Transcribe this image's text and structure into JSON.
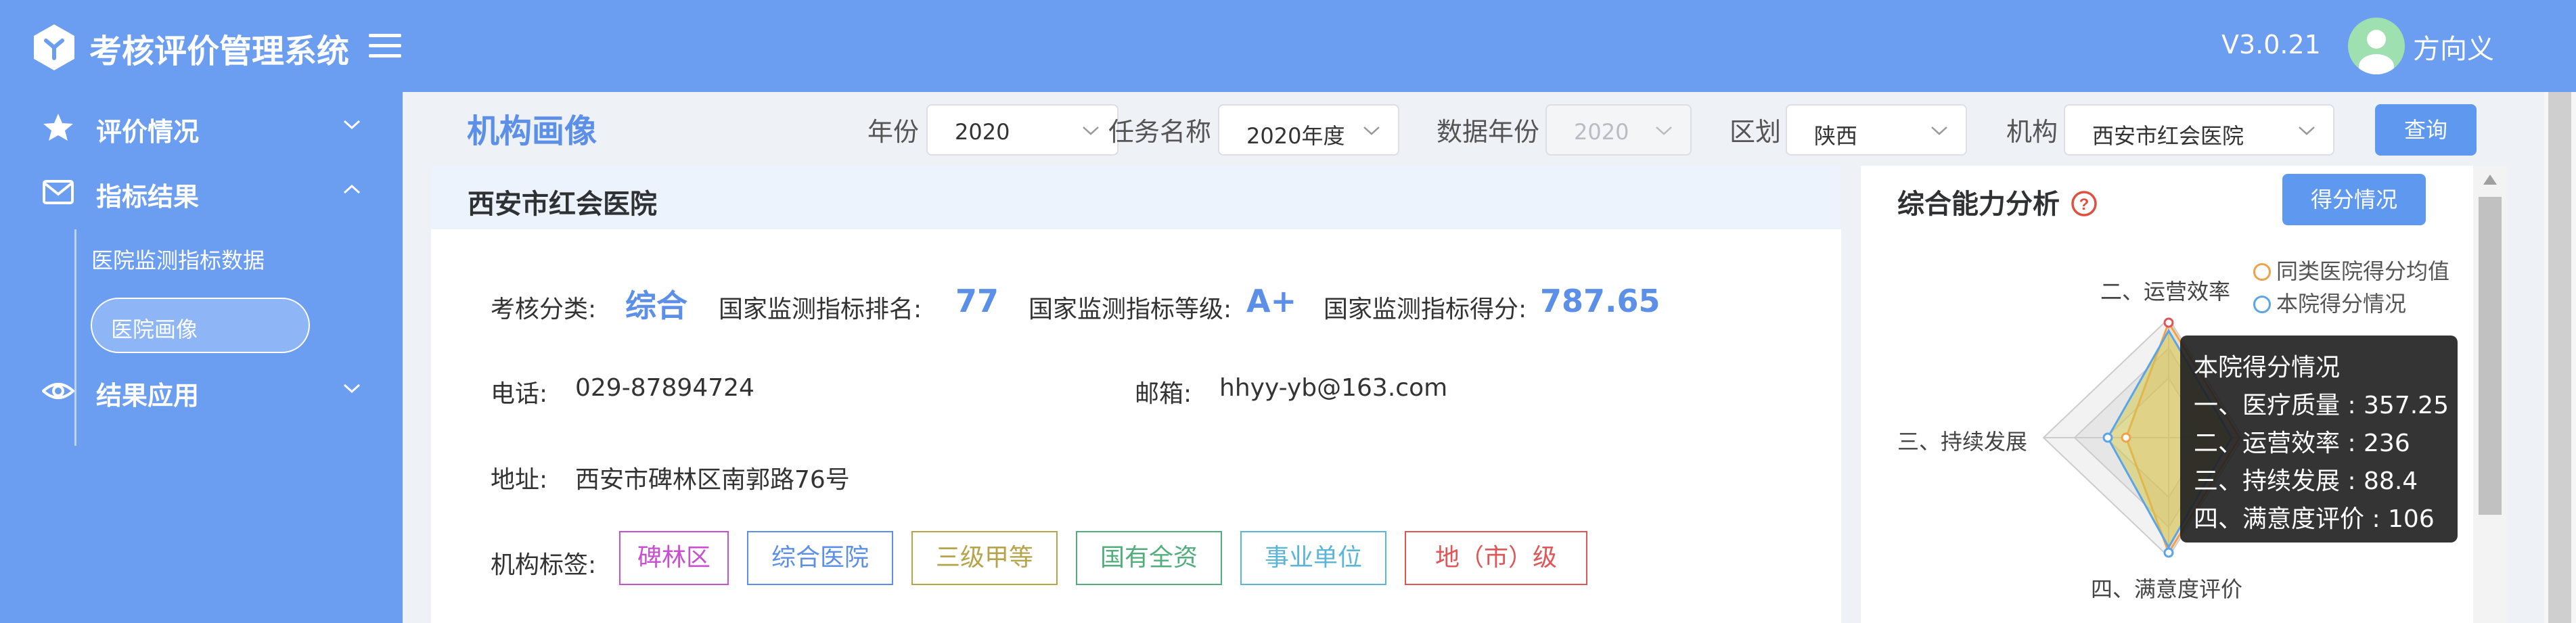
{
  "app": {
    "title": "考核评价管理系统",
    "version": "V3.0.21",
    "user": "方向义",
    "brand_color": "#6b9df0"
  },
  "sidebar": {
    "items": [
      {
        "label": "评价情况",
        "icon": "star-icon",
        "expanded": false
      },
      {
        "label": "指标结果",
        "icon": "mail-icon",
        "expanded": true,
        "children": [
          {
            "label": "医院监测指标数据",
            "active": false
          },
          {
            "label": "医院画像",
            "active": true
          }
        ]
      },
      {
        "label": "结果应用",
        "icon": "eye-icon",
        "expanded": false
      }
    ]
  },
  "page": {
    "title": "机构画像"
  },
  "filters": {
    "year_label": "年份",
    "year_value": "2020",
    "task_label": "任务名称",
    "task_value": "2020年度",
    "data_year_label": "数据年份",
    "data_year_value": "2020",
    "region_label": "区划",
    "region_value": "陕西",
    "org_label": "机构",
    "org_value": "西安市红会医院",
    "query_button": "查询"
  },
  "org_card": {
    "name": "西安市红会医院",
    "category_label": "考核分类:",
    "category_value": "综合",
    "rank_label": "国家监测指标排名:",
    "rank_value": "77",
    "grade_label": "国家监测指标等级:",
    "grade_value": "A+",
    "score_label": "国家监测指标得分:",
    "score_value": "787.65",
    "phone_label": "电话:",
    "phone_value": "029-87894724",
    "email_label": "邮箱:",
    "email_value": "hhyy-yb@163.com",
    "address_label": "地址:",
    "address_value": "西安市碑林区南郭路76号",
    "tags_label": "机构标签:",
    "tags": [
      {
        "label": "碑林区",
        "color": "#c84fd0"
      },
      {
        "label": "综合医院",
        "color": "#5b8fe8"
      },
      {
        "label": "三级甲等",
        "color": "#b6a44a"
      },
      {
        "label": "国有全资",
        "color": "#4fae79"
      },
      {
        "label": "事业单位",
        "color": "#5bb5d8"
      },
      {
        "label": "地（市）级",
        "color": "#e05656"
      }
    ]
  },
  "analysis": {
    "title": "综合能力分析",
    "score_button": "得分情况",
    "axes": [
      "一、医疗质量",
      "二、运营效率",
      "三、持续发展",
      "四、满意度评价"
    ],
    "legend": [
      {
        "label": "同类医院得分均值",
        "color": "#f0a24a"
      },
      {
        "label": "本院得分情况",
        "color": "#5ba4e8"
      }
    ],
    "tooltip": {
      "title": "本院得分情况",
      "lines": [
        "一、医疗质量 : 357.25",
        "二、运营效率 : 236",
        "三、持续发展 : 88.4",
        "四、满意度评价 : 106"
      ]
    }
  }
}
